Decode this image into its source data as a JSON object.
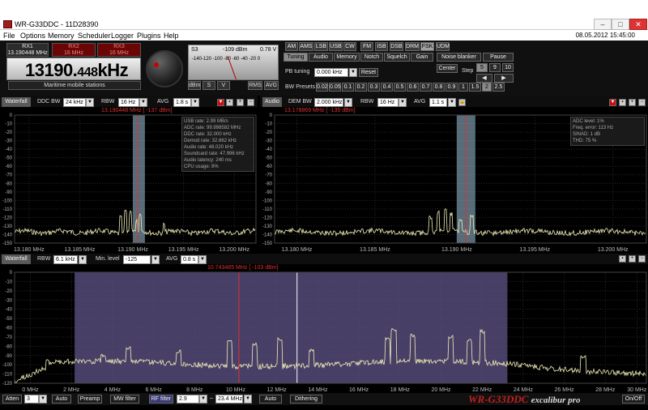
{
  "window": {
    "title": "WR-G33DDC - 11D28390",
    "minimize": "–",
    "maximize": "□",
    "close": "✕"
  },
  "menu": {
    "items": [
      "File",
      "Options",
      "Memory",
      "Scheduler",
      "Logger",
      "Plugins",
      "Help"
    ],
    "datetime": "08.05.2012 15:45:00"
  },
  "receiver": {
    "tabs": [
      {
        "label": "RX1",
        "freq": "13.190448 MHz"
      },
      {
        "label": "RX2",
        "freq": "16 MHz"
      },
      {
        "label": "RX3",
        "freq": "16 MHz"
      }
    ],
    "freq_main": "13190.",
    "freq_sub": "448",
    "freq_unit": "kHz",
    "station": "Maritime mobile stations"
  },
  "smeter": {
    "s_label": "S3",
    "dbm": "-109 dBm",
    "volts": "0.78  V",
    "scale": "-140-120  -100 -80 -60 -40 -20  0",
    "buttons": [
      "dBm",
      "S",
      "V",
      "RMS",
      "AVG"
    ]
  },
  "modes": {
    "items": [
      "AM",
      "AMS",
      "LSB",
      "USB",
      "CW",
      "FM",
      "ISB",
      "DSB",
      "DRM",
      "FSK",
      "UDM"
    ],
    "selected": "FSK"
  },
  "tabs": {
    "items": [
      "Tuning",
      "Audio",
      "Memory",
      "Notch",
      "Squelch",
      "Gain",
      "Noise blanker",
      "Pause"
    ],
    "selected": "Tuning"
  },
  "tuning": {
    "pb_label": "PB tuning",
    "pb_value": "0.000 kHz",
    "reset": "Reset",
    "center": "Center",
    "step_label": "Step",
    "steps_row1": [
      "5",
      "9",
      "10"
    ],
    "steps_row2": [
      "1",
      "1.5",
      "2",
      "2.5"
    ],
    "bw_label": "BW Presets",
    "bw_presets": [
      "0.02",
      "0.05",
      "0.1",
      "0.2",
      "0.3",
      "0.4",
      "0.5",
      "0.6",
      "0.7",
      "0.8",
      "0.9",
      "1",
      "1.5",
      "2",
      "2.5"
    ],
    "bw_selected": "2"
  },
  "ddc_panel": {
    "mode": "Waterfall",
    "ddc_label": "DDC BW",
    "ddc_value": "24 kHz",
    "rbw_label": "RBW",
    "rbw_value": "16 Hz",
    "avg_label": "AVG",
    "avg_value": "1.8 s",
    "marker": "13.190448 MHz [ -137 dBm]",
    "info": [
      "USB rate: 2.99 MB/s",
      "ADC rate: 99.998582 MHz",
      "DDC rate: 32.000 kHz",
      "Demod rate: 32.662 kHz",
      "Audio rate: 48.020 kHz",
      "Soundcard rate: 47.996 kHz",
      "Audio latency: 240 ms",
      "CPU usage: 8%"
    ],
    "y_ticks": [
      "0",
      "-10",
      "-20",
      "-30",
      "-40",
      "-50",
      "-60",
      "-70",
      "-80",
      "-90",
      "-100",
      "-110",
      "-120",
      "-130",
      "-140",
      "-150"
    ],
    "x_ticks": [
      "13.180 MHz",
      "13.185 MHz",
      "13.190 MHz",
      "13.195 MHz",
      "13.200 MHz"
    ]
  },
  "audio_panel": {
    "mode": "Audio",
    "dem_label": "DEM BW",
    "dem_value": "2.000 kHz",
    "rbw_label": "RBW",
    "rbw_value": "16 Hz",
    "avg_label": "AVG",
    "avg_value": "1.1 s",
    "marker": "13.178869 MHz [ -135 dBm]",
    "info": [
      "ADC level: 1%",
      "Freq. error: 113 Hz",
      "SINAD: 1 dB",
      "THD: 75 %"
    ],
    "y_ticks": [
      "0",
      "-10",
      "-20",
      "-30",
      "-40",
      "-50",
      "-60",
      "-70",
      "-80",
      "-90",
      "-100",
      "-110",
      "-120",
      "-130",
      "-140",
      "-150"
    ],
    "x_ticks": [
      "13.180 MHz",
      "13.185 MHz",
      "13.190 MHz",
      "13.195 MHz",
      "13.200 MHz"
    ]
  },
  "wide_panel": {
    "mode": "Waterfall",
    "rbw_label": "RBW",
    "rbw_value": "6.1 kHz",
    "min_label": "Min. level",
    "min_value": "-125 dBm",
    "avg_label": "AVG",
    "avg_value": "0.8 s",
    "marker": "10.743485 MHz [ -103 dBm]",
    "y_ticks": [
      "0",
      "-10",
      "-20",
      "-30",
      "-40",
      "-50",
      "-60",
      "-70",
      "-80",
      "-90",
      "-100",
      "-110",
      "-120"
    ],
    "x_ticks": [
      "0 MHz",
      "2 MHz",
      "4 MHz",
      "6 MHz",
      "8 MHz",
      "10 MHz",
      "12 MHz",
      "14 MHz",
      "16 MHz",
      "18 MHz",
      "20 MHz",
      "22 MHz",
      "24 MHz",
      "26 MHz",
      "28 MHz",
      "30 MHz"
    ]
  },
  "bottom": {
    "atten": "Atten",
    "atten_val": "3 dB",
    "auto1": "Auto",
    "preamp": "Preamp",
    "mw": "MW filter",
    "rf": "RF filter",
    "rf_lo": "2.9 MHz",
    "rf_hi": "23.4 MHz",
    "auto2": "Auto",
    "dither": "Dithering",
    "brand": "WR-G33DDC",
    "brand_sub": "excalibur pro",
    "onoff": "On/Off"
  },
  "colors": {
    "trace": "#f0efb8",
    "bandwidth": "#9fc3da",
    "marker": "#e03030",
    "window": "#5a4f80"
  }
}
